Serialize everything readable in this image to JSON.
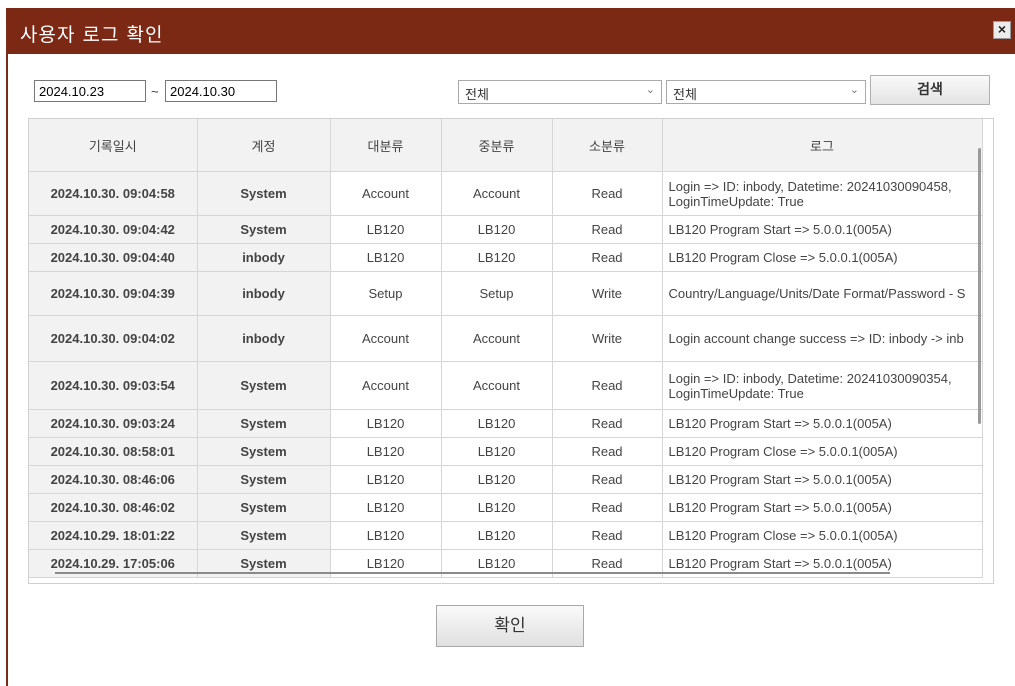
{
  "window": {
    "title": "사용자 로그 확인",
    "close_symbol": "×"
  },
  "filters": {
    "date_from": "2024.10.23",
    "date_separator": "~",
    "date_to": "2024.10.30",
    "select1": "전체",
    "select2": "전체",
    "search_label": "검색"
  },
  "table": {
    "headers": [
      "기록일시",
      "계정",
      "대분류",
      "중분류",
      "소분류",
      "로그"
    ],
    "rows": [
      {
        "date": "2024.10.30. 09:04:58",
        "account": "System",
        "major": "Account",
        "middle": "Account",
        "minor": "Read",
        "log": "Login => ID: inbody, Datetime: 20241030090458, LoginTimeUpdate: True"
      },
      {
        "date": "2024.10.30. 09:04:42",
        "account": "System",
        "major": "LB120",
        "middle": "LB120",
        "minor": "Read",
        "log": "LB120 Program Start => 5.0.0.1(005A)"
      },
      {
        "date": "2024.10.30. 09:04:40",
        "account": "inbody",
        "major": "LB120",
        "middle": "LB120",
        "minor": "Read",
        "log": "LB120 Program Close => 5.0.0.1(005A)"
      },
      {
        "date": "2024.10.30. 09:04:39",
        "account": "inbody",
        "major": "Setup",
        "middle": "Setup",
        "minor": "Write",
        "log": "Country/Language/Units/Date Format/Password - S"
      },
      {
        "date": "2024.10.30. 09:04:02",
        "account": "inbody",
        "major": "Account",
        "middle": "Account",
        "minor": "Write",
        "log": "Login account change success => ID: inbody -> inb"
      },
      {
        "date": "2024.10.30. 09:03:54",
        "account": "System",
        "major": "Account",
        "middle": "Account",
        "minor": "Read",
        "log": "Login => ID: inbody, Datetime: 20241030090354, LoginTimeUpdate: True"
      },
      {
        "date": "2024.10.30. 09:03:24",
        "account": "System",
        "major": "LB120",
        "middle": "LB120",
        "minor": "Read",
        "log": "LB120 Program Start => 5.0.0.1(005A)"
      },
      {
        "date": "2024.10.30. 08:58:01",
        "account": "System",
        "major": "LB120",
        "middle": "LB120",
        "minor": "Read",
        "log": "LB120 Program Close => 5.0.0.1(005A)"
      },
      {
        "date": "2024.10.30. 08:46:06",
        "account": "System",
        "major": "LB120",
        "middle": "LB120",
        "minor": "Read",
        "log": "LB120 Program Start => 5.0.0.1(005A)"
      },
      {
        "date": "2024.10.30. 08:46:02",
        "account": "System",
        "major": "LB120",
        "middle": "LB120",
        "minor": "Read",
        "log": "LB120 Program Start => 5.0.0.1(005A)"
      },
      {
        "date": "2024.10.29. 18:01:22",
        "account": "System",
        "major": "LB120",
        "middle": "LB120",
        "minor": "Read",
        "log": "LB120 Program Close => 5.0.0.1(005A)"
      },
      {
        "date": "2024.10.29. 17:05:06",
        "account": "System",
        "major": "LB120",
        "middle": "LB120",
        "minor": "Read",
        "log": "LB120 Program Start => 5.0.0.1(005A)"
      }
    ]
  },
  "footer": {
    "ok_label": "확인"
  },
  "colors": {
    "titlebar": "#7b2814",
    "header_bg": "#f2f2f2",
    "border": "#d6d6d6"
  }
}
